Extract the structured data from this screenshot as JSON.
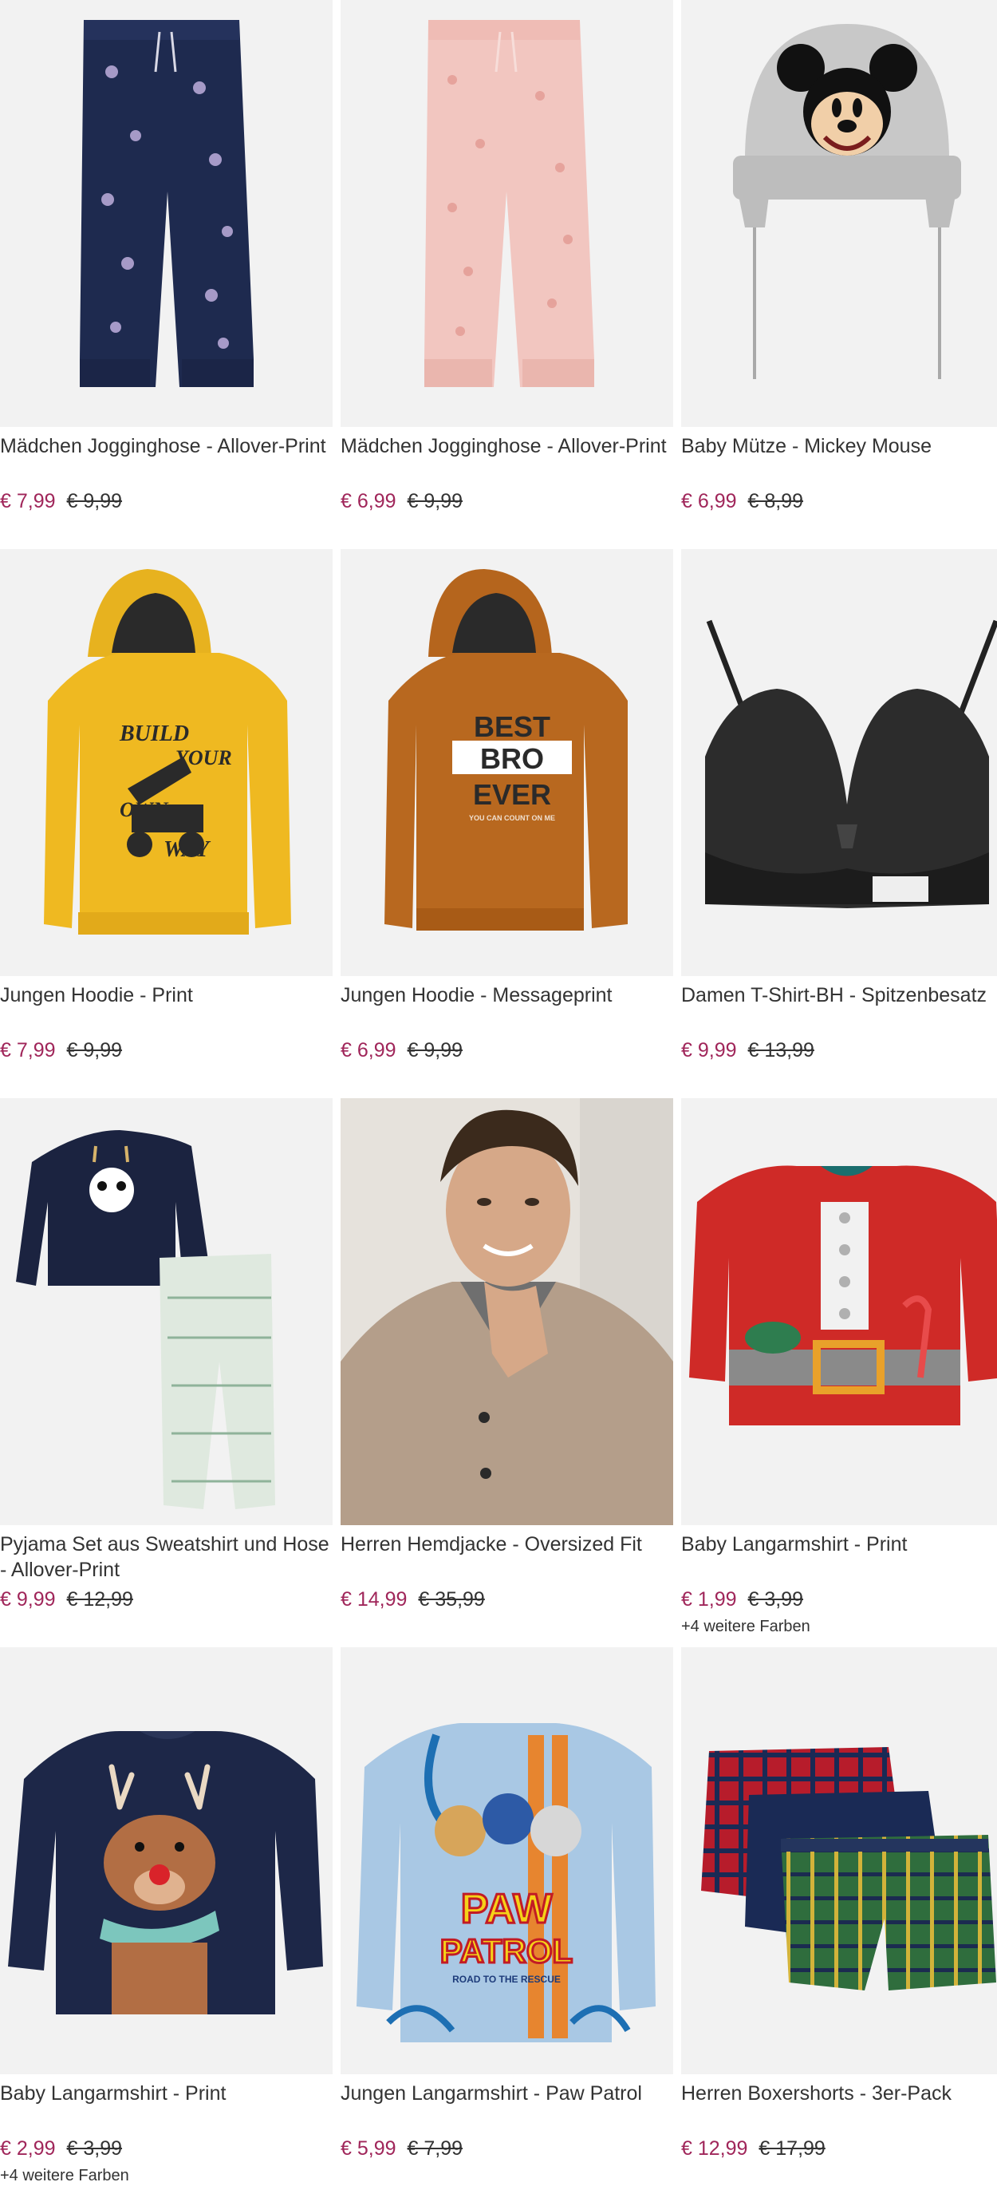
{
  "products": [
    {
      "title": "Mädchen Jogginghose - Allover-Print",
      "price_new": "€ 7,99",
      "price_old": "€ 9,99",
      "colors_note": "",
      "image_icon": "navy-unicorn-jogger-pants"
    },
    {
      "title": "Mädchen Jogginghose - Allover-Print",
      "price_new": "€ 6,99",
      "price_old": "€ 9,99",
      "colors_note": "",
      "image_icon": "pink-unicorn-jogger-pants"
    },
    {
      "title": "Baby Mütze - Mickey Mouse",
      "price_new": "€ 6,99",
      "price_old": "€ 8,99",
      "colors_note": "",
      "image_icon": "grey-mickey-beanie"
    },
    {
      "title": "Jungen Hoodie - Print",
      "price_new": "€ 7,99",
      "price_old": "€ 9,99",
      "colors_note": "",
      "image_icon": "yellow-excavator-hoodie"
    },
    {
      "title": "Jungen Hoodie - Messageprint",
      "price_new": "€ 6,99",
      "price_old": "€ 9,99",
      "colors_note": "",
      "image_icon": "brown-best-bro-hoodie"
    },
    {
      "title": "Damen T-Shirt-BH - Spitzenbesatz",
      "price_new": "€ 9,99",
      "price_old": "€ 13,99",
      "colors_note": "",
      "image_icon": "black-lace-bra"
    },
    {
      "title": "Pyjama Set aus Sweatshirt und Hose - Allover-Print",
      "price_new": "€ 9,99",
      "price_old": "€ 12,99",
      "colors_note": "",
      "image_icon": "panda-pyjama-set"
    },
    {
      "title": "Herren Hemdjacke - Oversized Fit",
      "price_new": "€ 14,99",
      "price_old": "€ 35,99",
      "colors_note": "",
      "image_icon": "man-beige-shirt-jacket-photo"
    },
    {
      "title": "Baby Langarmshirt - Print",
      "price_new": "€ 1,99",
      "price_old": "€ 3,99",
      "colors_note": "+4 weitere Farben",
      "image_icon": "red-santa-dino-longsleeve"
    },
    {
      "title": "Baby Langarmshirt - Print",
      "price_new": "€ 2,99",
      "price_old": "€ 3,99",
      "colors_note": "+4 weitere Farben",
      "image_icon": "navy-reindeer-longsleeve"
    },
    {
      "title": "Jungen Langarmshirt - Paw Patrol",
      "price_new": "€ 5,99",
      "price_old": "€ 7,99",
      "colors_note": "",
      "image_icon": "blue-paw-patrol-longsleeve"
    },
    {
      "title": "Herren Boxershorts - 3er-Pack",
      "price_new": "€ 12,99",
      "price_old": "€ 17,99",
      "colors_note": "",
      "image_icon": "plaid-boxershorts-3pack"
    }
  ],
  "paw_text": {
    "line1": "PAW",
    "line2": "PATROL",
    "line3": "ROAD TO THE RESCUE"
  },
  "hoodie_text": {
    "line1": "BEST",
    "line2": "BRO",
    "line3": "EVER",
    "line4": "YOU CAN COUNT ON ME"
  },
  "excavator_text": {
    "line1": "BUILD",
    "line2": "YOUR",
    "line3": "OWN",
    "line4": "WAY"
  },
  "colors": {
    "price_sale": "#a0265a",
    "image_bg": "#f2f2f2",
    "text": "#333333"
  }
}
